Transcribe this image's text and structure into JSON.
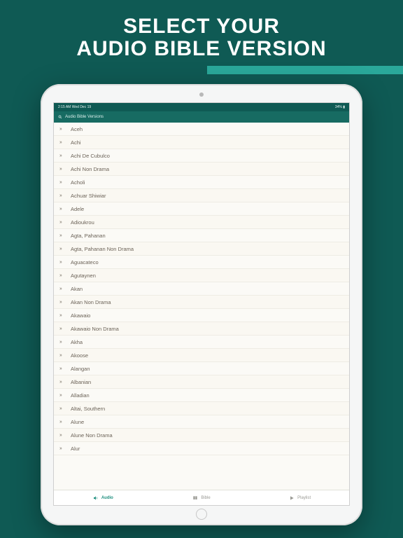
{
  "promo": {
    "headline_line1": "SELECT YOUR",
    "headline_line2": "AUDIO BIBLE VERSION"
  },
  "status_bar": {
    "left": "2:15 AM  Wed Dec 19",
    "right": "34% ▮"
  },
  "search": {
    "placeholder": "Audio Bible Versions"
  },
  "versions": [
    "Aceh",
    "Achi",
    "Achi De Cubulco",
    "Achi Non Drama",
    "Acholi",
    "Achuar Shiwiar",
    "Adele",
    "Adioukrou",
    "Agta, Pahanan",
    "Agta, Pahanan Non Drama",
    "Aguacateco",
    "Agutaynen",
    "Akan",
    "Akan Non Drama",
    "Akawaio",
    "Akawaio Non Drama",
    "Akha",
    "Akoose",
    "Alangan",
    "Albanian",
    "Alladian",
    "Altai, Southern",
    "Alune",
    "Alune Non Drama",
    "Alur"
  ],
  "tabs": {
    "audio": "Audio",
    "bible": "Bible",
    "playlist": "Playlist"
  }
}
